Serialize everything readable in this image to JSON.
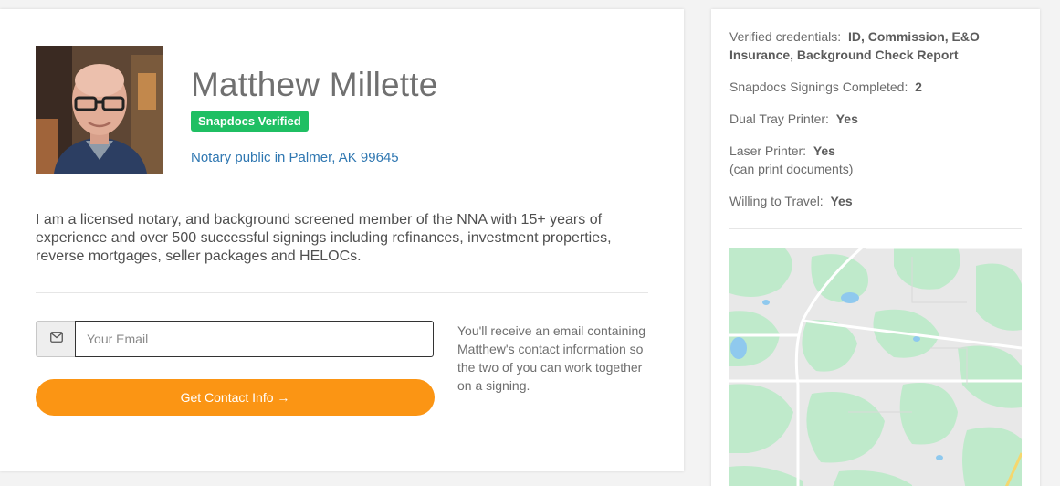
{
  "profile": {
    "name": "Matthew Millette",
    "badge": "Snapdocs Verified",
    "location": "Notary public in Palmer, AK 99645",
    "bio": "I am a licensed notary, and background screened member of the NNA with 15+ years of experience and over 500 successful signings including refinances, investment properties, reverse mortgages, seller packages and HELOCs."
  },
  "contact": {
    "email_placeholder": "Your Email",
    "email_value": "",
    "button_label": "Get Contact Info →",
    "info": "You'll receive an email containing Matthew's contact information so the two of you can work together on a signing.",
    "email_icon": "envelope-icon"
  },
  "sidebar": {
    "credentials_label": "Verified credentials:",
    "credentials_value": "ID, Commission, E&O Insurance, Background Check Report",
    "signings_label": "Snapdocs Signings Completed:",
    "signings_value": "2",
    "dual_tray_label": "Dual Tray Printer:",
    "dual_tray_value": "Yes",
    "laser_label": "Laser Printer:",
    "laser_value": "Yes",
    "laser_note": "(can print documents)",
    "travel_label": "Willing to Travel:",
    "travel_value": "Yes"
  },
  "colors": {
    "badge_green": "#1fbf63",
    "link_blue": "#2f77b1",
    "button_orange": "#fb9514"
  }
}
